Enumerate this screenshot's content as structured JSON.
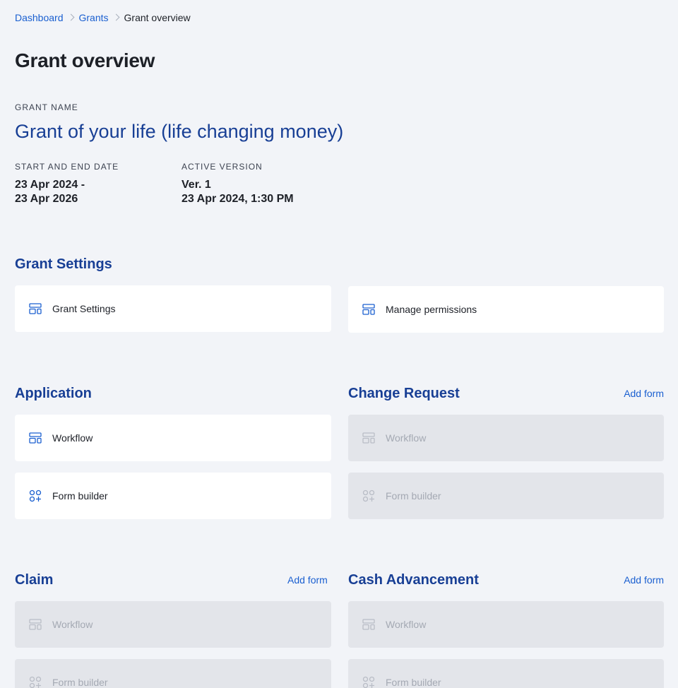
{
  "breadcrumb": {
    "items": [
      "Dashboard",
      "Grants"
    ],
    "current": "Grant overview"
  },
  "page_title": "Grant overview",
  "grant": {
    "name_label": "GRANT NAME",
    "name": "Grant of your life (life changing money)",
    "dates_label": "START AND END DATE",
    "dates_line1": "23 Apr 2024 -",
    "dates_line2": "23 Apr 2026",
    "version_label": "ACTIVE VERSION",
    "version": "Ver. 1",
    "version_date": "23 Apr 2024, 1:30 PM"
  },
  "sections": {
    "grant_settings": {
      "title": "Grant Settings",
      "cards": [
        "Grant Settings",
        "Manage permissions"
      ]
    },
    "application": {
      "title": "Application",
      "cards": [
        "Workflow",
        "Form builder"
      ]
    },
    "change_request": {
      "title": "Change Request",
      "add_form": "Add form",
      "cards": [
        "Workflow",
        "Form builder"
      ]
    },
    "claim": {
      "title": "Claim",
      "add_form": "Add form",
      "cards": [
        "Workflow",
        "Form builder"
      ]
    },
    "cash_advancement": {
      "title": "Cash Advancement",
      "add_form": "Add form",
      "cards": [
        "Workflow",
        "Form builder"
      ]
    }
  },
  "colors": {
    "accent": "#1a5fd0",
    "heading_blue": "#183f95",
    "background": "#f2f4f8",
    "card": "#ffffff",
    "card_disabled": "#e3e5ea"
  },
  "icons": {
    "layout": "layout-icon",
    "form_builder": "apps-add-icon"
  }
}
